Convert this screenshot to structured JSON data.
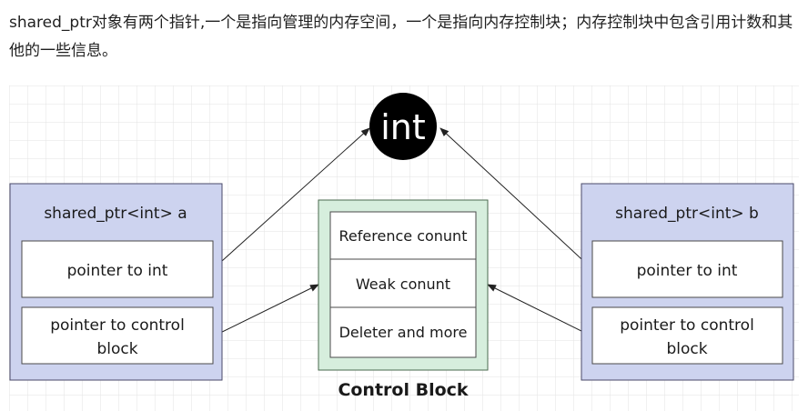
{
  "intro": {
    "text": "shared_ptr对象有两个指针,一个是指向管理的内存空间，一个是指向内存控制块；内存控制块中包含引用计数和其他的一些信息。"
  },
  "diagram": {
    "int_node": {
      "label": "int"
    },
    "left_object": {
      "title": "shared_ptr<int> a",
      "pointer_to_int": "pointer to int",
      "pointer_to_control_line1": "pointer to control",
      "pointer_to_control_line2": "block"
    },
    "right_object": {
      "title": "shared_ptr<int> b",
      "pointer_to_int": "pointer to int",
      "pointer_to_control_line1": "pointer to control",
      "pointer_to_control_line2": "block"
    },
    "control_block": {
      "caption": "Control Block",
      "reference_count": "Reference conunt",
      "weak_count": "Weak conunt",
      "deleter": "Deleter and more"
    },
    "colors": {
      "object_fill": "#cdd3ef",
      "object_stroke": "#4a4a6a",
      "control_fill": "#d6eedd",
      "control_stroke": "#4a6a4e",
      "int_fill": "#000000",
      "int_text": "#ffffff",
      "grid": "#e3e3e3"
    }
  }
}
